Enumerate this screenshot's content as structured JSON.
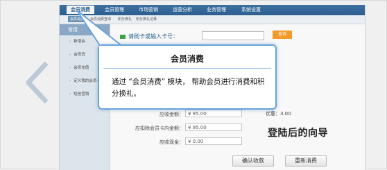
{
  "menubar": {
    "items": [
      "会员消费",
      "会员管理",
      "市场营销",
      "运营分析",
      "业务管理",
      "系统设置"
    ],
    "active_index": 0
  },
  "submenu": {
    "items": [
      "会员消费",
      "会员消费查询",
      "积分换礼",
      "积分换礼记录"
    ]
  },
  "sidebar": {
    "header": "常用",
    "items": [
      "新增会",
      "会员消",
      "会员充值",
      "定义我的会员卡",
      "短信营销"
    ]
  },
  "card": {
    "label": "请刷卡或输入卡号：",
    "query_button": "查询"
  },
  "form": {
    "discount_label": "优惠：",
    "discount_value": "3.00",
    "receivable_label": "应收金额：",
    "receivable_value": "¥ 95.00",
    "deduct_label": "应扣除会员卡内金额：",
    "deduct_value": "¥ 95.00",
    "cash_label": "应收现金：",
    "cash_value": "¥ 0.00"
  },
  "buttons": {
    "confirm": "确认收款",
    "restart": "重新消费"
  },
  "tooltip": {
    "title": "会员消费",
    "body": "通过 “会员消费” 模块， 帮助会员进行消费和积分换礼。"
  },
  "tour_caption": "登陆后的向导",
  "colors": {
    "menubar": "#2c5f91",
    "accent": "#f39a2b",
    "tooltip_border": "#6aa3d8",
    "arrow": "#bcc9d6"
  }
}
